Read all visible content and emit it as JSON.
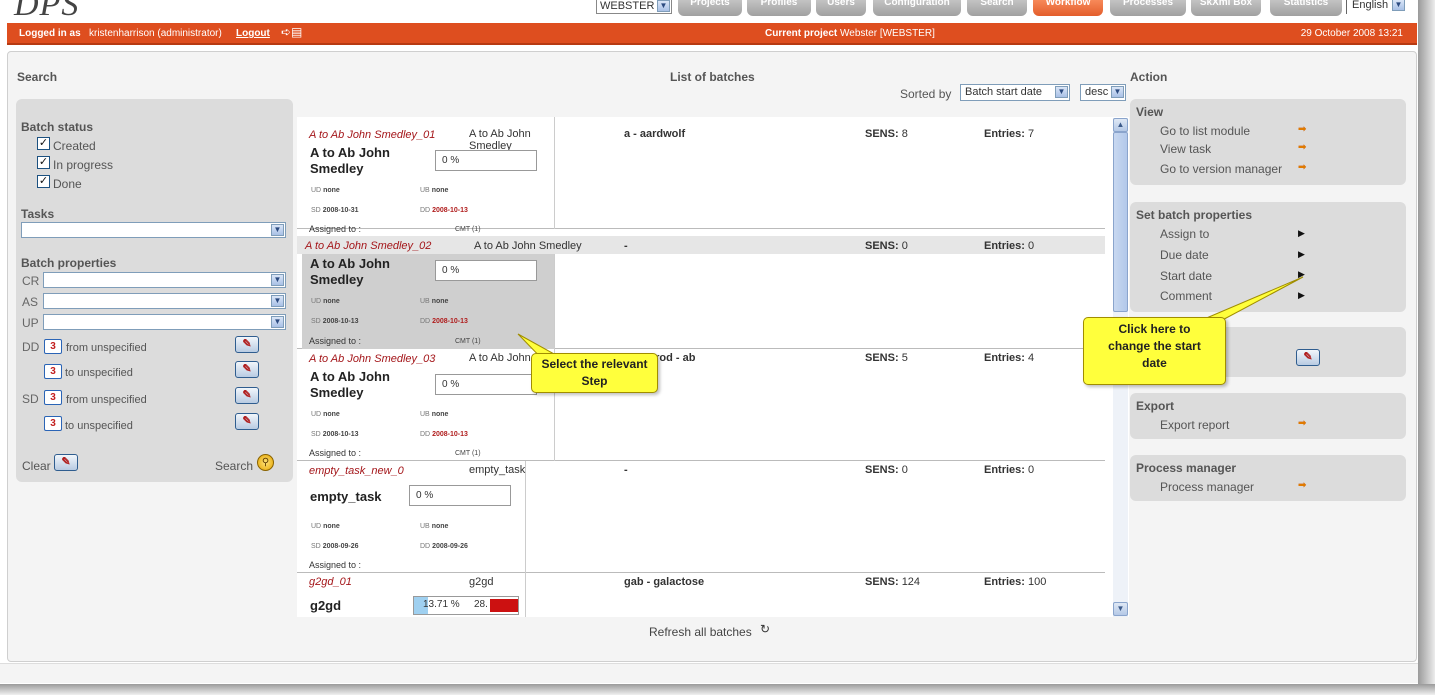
{
  "app": {
    "logo": "DPS"
  },
  "topnav": {
    "project_select": "WEBSTER",
    "tabs": [
      "Projects",
      "Profiles",
      "Users",
      "Configuration",
      "Search",
      "Workflow",
      "Processes",
      "SkXml Box",
      "Statistics"
    ],
    "active_tab": "Workflow",
    "language": "English"
  },
  "status_bar": {
    "logged_in_label": "Logged in as",
    "user": "kristenharrison (administrator)",
    "logout": "Logout",
    "current_project_label": "Current project",
    "current_project": "Webster [WEBSTER]",
    "datetime": "29 October 2008 13:21",
    "accent_color": "#de4e1f"
  },
  "search_panel": {
    "title": "Search",
    "batch_status_label": "Batch status",
    "statuses": [
      {
        "label": "Created",
        "checked": true
      },
      {
        "label": "In progress",
        "checked": true
      },
      {
        "label": "Done",
        "checked": true
      }
    ],
    "tasks_label": "Tasks",
    "tasks_value": "",
    "batch_properties_label": "Batch properties",
    "properties": [
      "CR",
      "AS",
      "UP"
    ],
    "date_filters": [
      {
        "code": "DD",
        "icon_text": "3",
        "text": "from unspecified"
      },
      {
        "code": "",
        "icon_text": "3",
        "text": "to unspecified"
      },
      {
        "code": "SD",
        "icon_text": "3",
        "text": "from unspecified"
      },
      {
        "code": "",
        "icon_text": "3",
        "text": "to unspecified"
      }
    ],
    "clear_label": "Clear",
    "search_label": "Search"
  },
  "batches_panel": {
    "title": "List of batches",
    "sorted_by_label": "Sorted by",
    "sort_field": "Batch start date",
    "sort_order": "desc",
    "refresh_label": "Refresh all batches",
    "batches": [
      {
        "id": "A to Ab John Smedley_01",
        "task": "A to Ab John Smedley",
        "title": "A to Ab John Smedley",
        "progress": "0 %",
        "ud": "none",
        "ub": "none",
        "sd": "2008-10-31",
        "dd": "2008-10-13",
        "assigned_label": "Assigned to :",
        "assignee": "CMT (1)",
        "range": "a - aardwolf",
        "sens_label": "SENS:",
        "sens": "8",
        "entries_label": "Entries:",
        "entries": "7",
        "selected": false
      },
      {
        "id": "A to Ab John Smedley_02",
        "task": "A to Ab John Smedley",
        "title": "A to Ab John Smedley",
        "progress": "0 %",
        "ud": "none",
        "ub": "none",
        "sd": "2008-10-13",
        "dd": "2008-10-13",
        "assigned_label": "Assigned to :",
        "assignee": "CMT (1)",
        "range": "-",
        "sens_label": "SENS:",
        "sens": "0",
        "entries_label": "Entries:",
        "entries": "0",
        "selected": true
      },
      {
        "id": "A to Ab John Smedley_03",
        "task": "A to Ab John",
        "title": "A to Ab John Smedley",
        "progress": "0 %",
        "ud": "none",
        "ub": "none",
        "sd": "2008-10-13",
        "dd": "2008-10-13",
        "assigned_label": "Assigned to :",
        "assignee": "CMT (1)",
        "range": "srod - ab",
        "sens_label": "SENS:",
        "sens": "5",
        "entries_label": "Entries:",
        "entries": "4",
        "selected": false
      },
      {
        "id": "empty_task_new_0",
        "task": "empty_task",
        "title": "empty_task",
        "progress": "0 %",
        "ud": "none",
        "ub": "none",
        "sd": "2008-09-26",
        "dd": "2008-09-26",
        "assigned_label": "Assigned to :",
        "assignee": "",
        "range": "-",
        "sens_label": "SENS:",
        "sens": "0",
        "entries_label": "Entries:",
        "entries": "0",
        "selected": false
      },
      {
        "id": "g2gd_01",
        "task": "g2gd",
        "title": "g2gd",
        "progress": "13.71 %",
        "progress2": "28.",
        "range": "gab - galactose",
        "sens_label": "SENS:",
        "sens": "124",
        "entries_label": "Entries:",
        "entries": "100",
        "selected": false
      }
    ]
  },
  "labels": {
    "ud": "UD",
    "ub": "UB",
    "sd": "SD",
    "dd": "DD"
  },
  "action_panel": {
    "title": "Action",
    "view": {
      "title": "View",
      "items": [
        "Go to list module",
        "View task",
        "Go to version manager"
      ]
    },
    "set_props": {
      "title": "Set batch properties",
      "items": [
        "Assign to",
        "Due date",
        "Start date",
        "Comment"
      ]
    },
    "tasks_box": {
      "item": "ks"
    },
    "export": {
      "title": "Export",
      "item": "Export report"
    },
    "process_manager": {
      "title": "Process manager",
      "item": "Process manager"
    }
  },
  "callouts": {
    "select_step": "Select the relevant Step",
    "start_date": "Click here to change the start date"
  }
}
